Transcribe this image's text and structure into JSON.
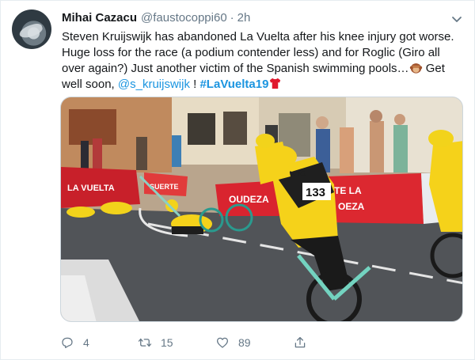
{
  "tweet": {
    "display_name": "Mihai Cazacu",
    "handle": "@faustocoppi60",
    "separator": "·",
    "time": "2h",
    "text_part1": "Steven Kruijswijk has abandoned La Vuelta after his knee injury got worse. Huge loss for the race (a podium contender less) and for Roglic (Giro all over again?) Just another victim of the Spanish swimming pools…",
    "text_part2": " Get well soon, ",
    "mention": "@s_kruijswijk",
    "text_part3": " ! ",
    "hashtag": "#LaVuelta19",
    "emoji1": "see-no-evil-monkey",
    "emoji2": "red-jersey",
    "media": {
      "banner_text_1": "LA VUELTA",
      "banner_text_2": "SUERTE",
      "banner_text_3": "LA VUELTA",
      "banner_text_4": "OUDEZA",
      "banner_text_5": "TE LA",
      "banner_text_6": "OEZA",
      "rider_number": "133",
      "jersey_brand": "JUMBO",
      "jersey_sub": "visma"
    },
    "actions": {
      "reply_count": "4",
      "retweet_count": "15",
      "like_count": "89"
    },
    "colors": {
      "link": "#1b95e0",
      "muted": "#657786",
      "jersey_yellow": "#f5d21a",
      "banner_red": "#d9242f"
    }
  }
}
